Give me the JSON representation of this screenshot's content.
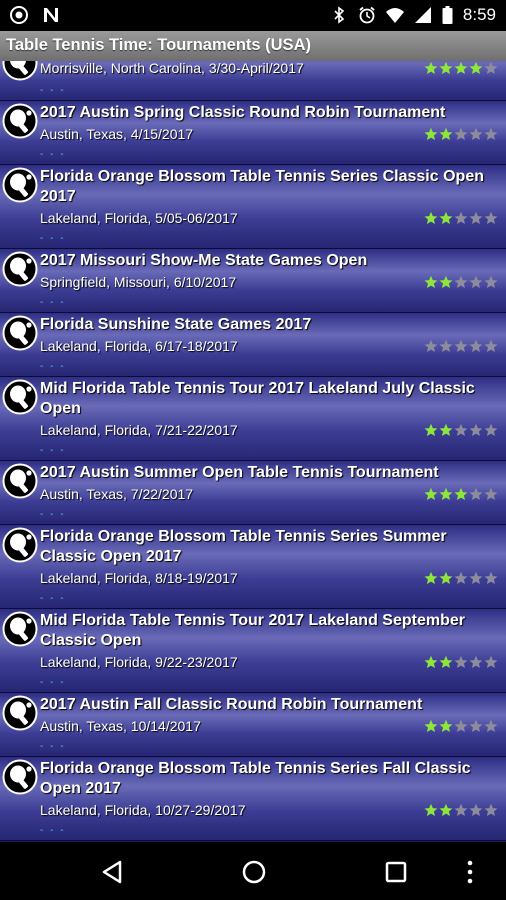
{
  "status_bar": {
    "time": "8:59",
    "icons": [
      "target-icon",
      "n-notification-icon",
      "bluetooth-icon",
      "alarm-icon",
      "wifi-icon",
      "cellular-icon",
      "battery-icon"
    ]
  },
  "app": {
    "title": "Table Tennis Time: Tournaments (USA)"
  },
  "colors": {
    "star_on": "#8ee63b",
    "star_off": "#8c8c9c",
    "dots": "#5bb8ff"
  },
  "tournaments": [
    {
      "title": "",
      "subtitle": "Morrisville, North Carolina, 3/30-April/2017",
      "rating": 4
    },
    {
      "title": "2017 Austin Spring Classic Round Robin Tournament",
      "subtitle": "Austin, Texas, 4/15/2017",
      "rating": 2
    },
    {
      "title": "Florida Orange Blossom Table Tennis Series Classic Open 2017",
      "subtitle": "Lakeland, Florida, 5/05-06/2017",
      "rating": 2
    },
    {
      "title": "2017 Missouri Show-Me State Games Open",
      "subtitle": "Springfield, Missouri, 6/10/2017",
      "rating": 2
    },
    {
      "title": "Florida Sunshine State Games 2017",
      "subtitle": "Lakeland, Florida, 6/17-18/2017",
      "rating": 0
    },
    {
      "title": "Mid Florida Table Tennis Tour 2017 Lakeland July Classic Open",
      "subtitle": "Lakeland, Florida, 7/21-22/2017",
      "rating": 2
    },
    {
      "title": "2017 Austin Summer Open Table Tennis Tournament",
      "subtitle": "Austin, Texas, 7/22/2017",
      "rating": 3
    },
    {
      "title": "Florida Orange Blossom Table Tennis Series Summer Classic Open 2017",
      "subtitle": "Lakeland, Florida, 8/18-19/2017",
      "rating": 2
    },
    {
      "title": "Mid Florida Table Tennis Tour 2017 Lakeland September Classic Open",
      "subtitle": "Lakeland, Florida, 9/22-23/2017",
      "rating": 2
    },
    {
      "title": "2017 Austin Fall Classic Round Robin Tournament",
      "subtitle": "Austin, Texas, 10/14/2017",
      "rating": 2
    },
    {
      "title": "Florida Orange Blossom Table Tennis Series Fall Classic Open 2017",
      "subtitle": "Lakeland, Florida, 10/27-29/2017",
      "rating": 2
    }
  ],
  "nav_bar": {
    "buttons": [
      "back-icon",
      "home-icon",
      "recents-icon",
      "overflow-menu-icon"
    ]
  }
}
